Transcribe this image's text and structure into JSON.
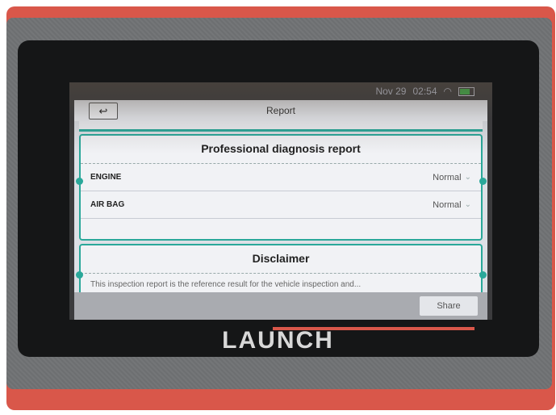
{
  "status_bar": {
    "date": "Nov 29",
    "time": "02:54"
  },
  "titlebar": {
    "title": "Report",
    "back_icon": "back-arrow-icon"
  },
  "report": {
    "title": "Professional diagnosis report",
    "rows": [
      {
        "label": "ENGINE",
        "value": "Normal"
      },
      {
        "label": "AIR BAG",
        "value": "Normal"
      }
    ]
  },
  "disclaimer": {
    "title": "Disclaimer",
    "text": "This inspection report is the reference result for the vehicle inspection and..."
  },
  "bottom_bar": {
    "share_label": "Share"
  },
  "device": {
    "brand": "LAUNCH"
  },
  "colors": {
    "accent": "#2aa89a",
    "shell": "#d9574a",
    "battery": "#3ec34a"
  }
}
